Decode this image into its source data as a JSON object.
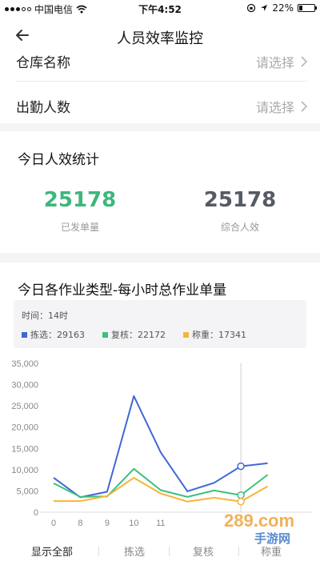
{
  "status_bar": {
    "carrier": "中国电信",
    "time": "下午4:52",
    "battery": "22%",
    "battery_level": 0.22
  },
  "nav": {
    "title": "人员效率监控"
  },
  "form": {
    "rows": [
      {
        "label": "仓库名称",
        "value": "请选择"
      },
      {
        "label": "出勤人数",
        "value": "请选择"
      }
    ]
  },
  "stats": {
    "title": "今日人效统计",
    "items": [
      {
        "value": "25178",
        "label": "已发单量",
        "color": "#3cb77b"
      },
      {
        "value": "25178",
        "label": "综合人效",
        "color": "#555b63"
      }
    ]
  },
  "chart_section": {
    "title": "今日各作业类型-每小时总作业单量",
    "tooltip": {
      "time": "时间：14时"
    },
    "legend": [
      {
        "label": "拣选：29163",
        "color": "#4167d6"
      },
      {
        "label": "复核：22172",
        "color": "#3ec07c"
      },
      {
        "label": "称重：17341",
        "color": "#f5b53a"
      }
    ]
  },
  "chart_data": {
    "type": "line",
    "categories": [
      "0",
      "8",
      "9",
      "10",
      "11",
      "",
      "",
      "",
      "",
      ""
    ],
    "y_ticks": [
      "35,000",
      "30,000",
      "25,000",
      "20,000",
      "15,000",
      "10,000",
      "5,000",
      "0"
    ],
    "ylim": [
      0,
      35000
    ],
    "grid": false,
    "series": [
      {
        "name": "拣选",
        "color": "#4167d6",
        "values": [
          8100,
          3500,
          4800,
          27300,
          14100,
          4900,
          6900,
          10800,
          11500
        ]
      },
      {
        "name": "复核",
        "color": "#3ec07c",
        "values": [
          6800,
          3600,
          3700,
          10200,
          5200,
          3600,
          5100,
          4000,
          8800
        ]
      },
      {
        "name": "称重",
        "color": "#f5b53a",
        "values": [
          2600,
          2600,
          3800,
          8100,
          4400,
          2500,
          3400,
          2500,
          6100
        ]
      }
    ],
    "highlight_index": 7
  },
  "filter_tabs": [
    "显示全部",
    "拣选",
    "复核",
    "称重"
  ],
  "watermark": {
    "text_top": "289.com",
    "text_bottom": "手游网"
  }
}
